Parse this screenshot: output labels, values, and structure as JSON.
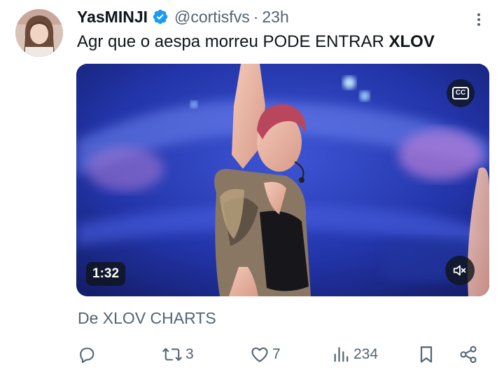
{
  "tweet": {
    "display_name": "YasMINJI",
    "handle": "@cortisfvs",
    "separator": "·",
    "time": "23h",
    "text_main": "Agr que o aespa morreu PODE ENTRAR ",
    "text_bold": "XLOV"
  },
  "media": {
    "duration": "1:32",
    "cc_label": "CC"
  },
  "source_label": "De XLOV CHARTS",
  "actions": {
    "retweets": "3",
    "likes": "7",
    "views": "234"
  },
  "colors": {
    "text_primary": "#0f1419",
    "text_secondary": "#536471",
    "verified_blue": "#1d9bf0"
  }
}
